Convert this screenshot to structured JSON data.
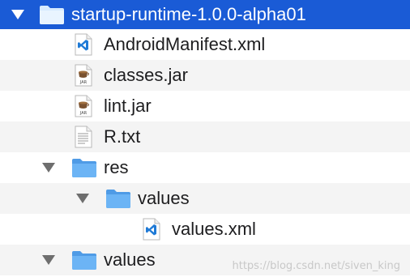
{
  "tree": {
    "root": {
      "label": "startup-runtime-1.0.0-alpha01",
      "icon": "folder-icon",
      "expanded": true
    },
    "items": [
      {
        "label": "AndroidManifest.xml",
        "icon": "vscode-file-icon"
      },
      {
        "label": "classes.jar",
        "icon": "jar-file-icon"
      },
      {
        "label": "lint.jar",
        "icon": "jar-file-icon"
      },
      {
        "label": "R.txt",
        "icon": "text-file-icon"
      },
      {
        "label": "res",
        "icon": "folder-icon",
        "expanded": true
      },
      {
        "label": "values",
        "icon": "folder-icon",
        "expanded": true
      },
      {
        "label": "values.xml",
        "icon": "vscode-file-icon"
      },
      {
        "label": "values",
        "icon": "folder-icon",
        "expanded": true
      }
    ],
    "jar_badge": "JAR"
  },
  "watermark": "https://blog.csdn.net/siven_king",
  "colors": {
    "selection": "#1a5bd6",
    "folder": "#5fa8f0",
    "alt_row": "#f4f4f4",
    "vscode_blue": "#1f7ad6"
  }
}
